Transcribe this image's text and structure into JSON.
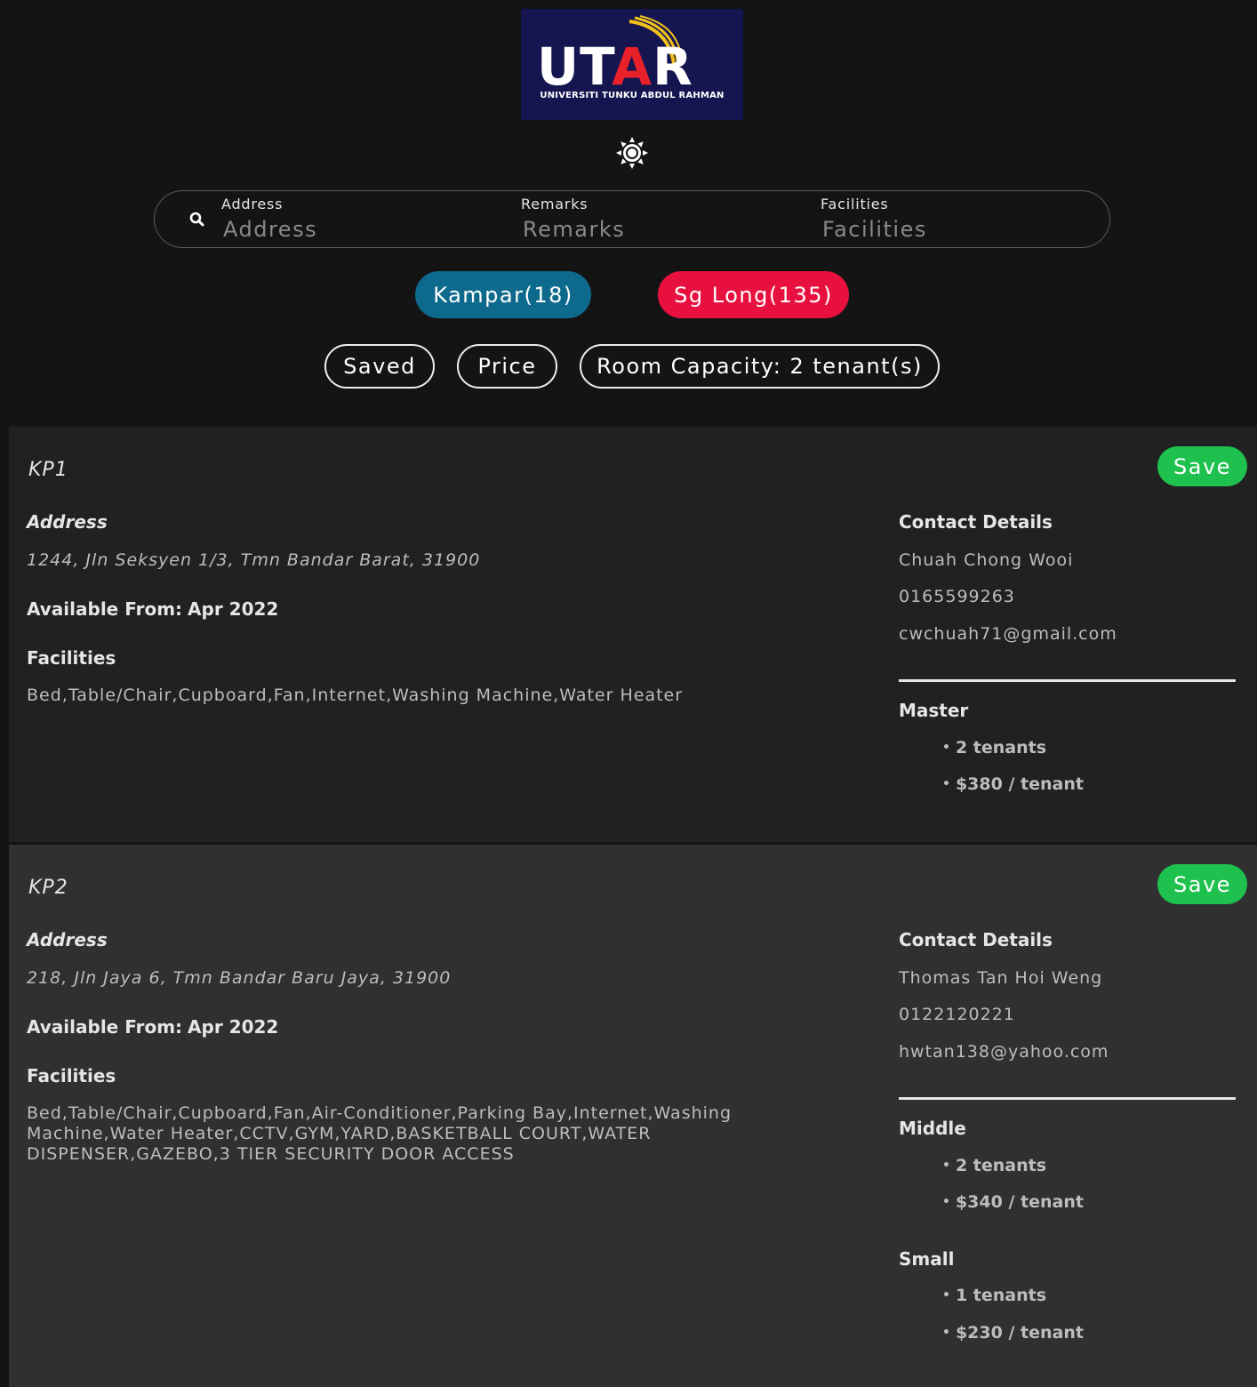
{
  "logo": {
    "wordmark_pre": "UT",
    "wordmark_a": "A",
    "wordmark_post": "R",
    "subtitle": "UNIVERSITI TUNKU ABDUL RAHMAN"
  },
  "theme_toggle": {
    "icon": "sun-icon"
  },
  "search": {
    "address_label": "Address",
    "address_placeholder": "Address",
    "remarks_label": "Remarks",
    "remarks_placeholder": "Remarks",
    "facilities_label": "Facilities",
    "facilities_placeholder": "Facilities"
  },
  "locations": {
    "kampar": "Kampar(18)",
    "sglong": "Sg Long(135)"
  },
  "filters": {
    "saved": "Saved",
    "price": "Price",
    "capacity": "Room Capacity: 2 tenant(s)"
  },
  "colors": {
    "kampar": "#0e6a8d",
    "sglong": "#e8103f",
    "save": "#1fc14e"
  },
  "listings": [
    {
      "title": "KP1",
      "save_label": "Save",
      "address_heading": "Address",
      "address": "1244, Jln Seksyen 1/3, Tmn Bandar Barat, 31900",
      "available_label": "Available From:",
      "available_value": "Apr 2022",
      "facilities_heading": "Facilities",
      "facilities": "Bed,Table/Chair,Cupboard,Fan,Internet,Washing Machine,Water Heater",
      "contact_heading": "Contact Details",
      "contact_name": "Chuah Chong Wooi",
      "contact_phone": "0165599263",
      "contact_email": "cwchuah71@gmail.com",
      "rooms": [
        {
          "name": "Master",
          "tenants": "2 tenants",
          "price": "$380 / tenant"
        }
      ]
    },
    {
      "title": "KP2",
      "save_label": "Save",
      "address_heading": "Address",
      "address": "218, Jln Jaya 6, Tmn Bandar Baru Jaya, 31900",
      "available_label": "Available From:",
      "available_value": "Apr 2022",
      "facilities_heading": "Facilities",
      "facilities": "Bed,Table/Chair,Cupboard,Fan,Air-Conditioner,Parking Bay,Internet,Washing Machine,Water Heater,CCTV,GYM,YARD,BASKETBALL COURT,WATER DISPENSER,GAZEBO,3 TIER SECURITY DOOR ACCESS",
      "contact_heading": "Contact Details",
      "contact_name": "Thomas Tan Hoi Weng",
      "contact_phone": "0122120221",
      "contact_email": "hwtan138@yahoo.com",
      "rooms": [
        {
          "name": "Middle",
          "tenants": "2 tenants",
          "price": "$340 / tenant"
        },
        {
          "name": "Small",
          "tenants": "1 tenants",
          "price": "$230 / tenant"
        }
      ]
    }
  ]
}
